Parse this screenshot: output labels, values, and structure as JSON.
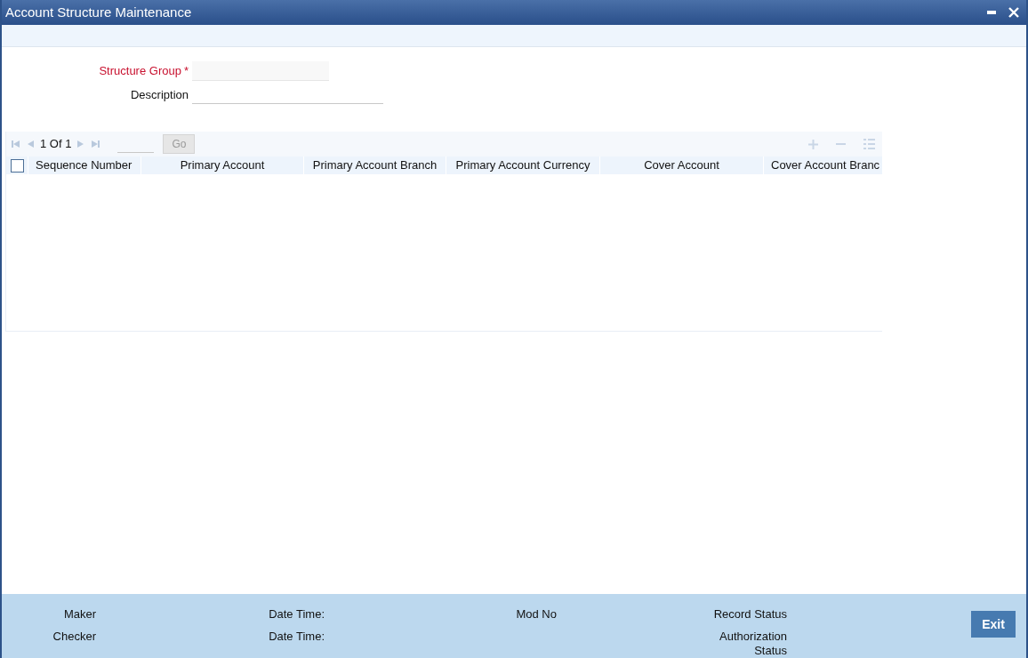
{
  "window": {
    "title": "Account Structure Maintenance"
  },
  "form": {
    "fields": [
      {
        "label": "Structure Group",
        "required": true,
        "required_mark": "*"
      },
      {
        "label": "Description",
        "required": false
      }
    ]
  },
  "grid": {
    "pager": {
      "text": "1 Of 1",
      "go": "Go",
      "disabled": true
    },
    "actions_disabled": true,
    "select_all": {
      "checked": false
    },
    "columns": [
      {
        "label": "Sequence Number"
      },
      {
        "label": "Primary Account"
      },
      {
        "label": "Primary Account Branch"
      },
      {
        "label": "Primary Account Currency"
      },
      {
        "label": "Cover Account"
      },
      {
        "label": "Cover Account Branc"
      }
    ]
  },
  "footer": {
    "columns": [
      {
        "labels": [
          "Maker",
          "Checker"
        ]
      },
      {
        "labels": [
          "Date Time:",
          "Date Time:"
        ]
      },
      {
        "labels": [
          "Mod No"
        ]
      },
      {
        "labels": [
          "Record Status",
          "Authorization Status"
        ]
      }
    ],
    "exit": "Exit"
  }
}
